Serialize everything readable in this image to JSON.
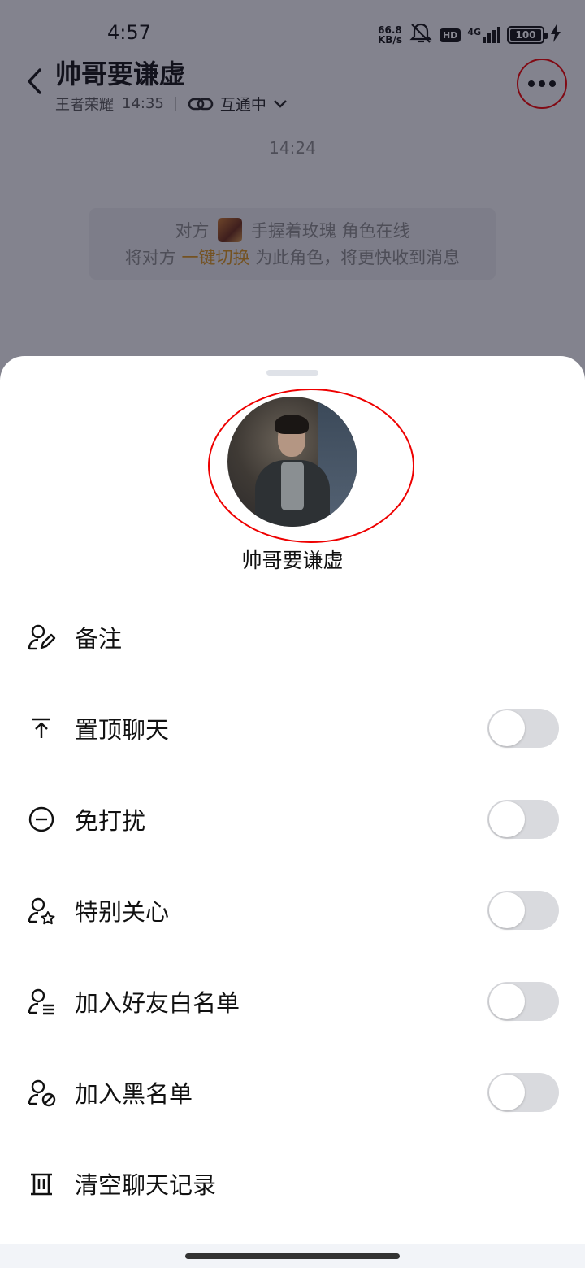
{
  "status_bar": {
    "time": "4:57",
    "net_speed_value": "66.8",
    "net_speed_unit": "KB/s",
    "hd_badge": "HD",
    "network": "4G",
    "battery": "100"
  },
  "chat_header": {
    "title": "帅哥要谦虚",
    "game_name": "王者荣耀",
    "last_time": "14:35",
    "link_status": "互通中"
  },
  "messages": {
    "timestamp": "14:24",
    "system_tip": {
      "line1_prefix": "对方",
      "line1_suffix": "手握着玫瑰 角色在线",
      "line2_prefix": "将对方",
      "line2_link": "一键切换",
      "line2_suffix": "为此角色，将更快收到消息"
    }
  },
  "sheet": {
    "profile_name": "帅哥要谦虚",
    "menu": [
      {
        "label": "备注",
        "icon": "user-edit-icon",
        "toggle": null
      },
      {
        "label": "置顶聊天",
        "icon": "pin-top-icon",
        "toggle": false
      },
      {
        "label": "免打扰",
        "icon": "do-not-disturb-icon",
        "toggle": false
      },
      {
        "label": "特别关心",
        "icon": "user-star-icon",
        "toggle": false
      },
      {
        "label": "加入好友白名单",
        "icon": "user-list-icon",
        "toggle": false
      },
      {
        "label": "加入黑名单",
        "icon": "user-block-icon",
        "toggle": false
      },
      {
        "label": "清空聊天记录",
        "icon": "trash-icon",
        "toggle": null
      }
    ]
  },
  "colors": {
    "accent": "#d4901a",
    "annotation": "#e00000",
    "toggle_off": "#d9dade"
  }
}
